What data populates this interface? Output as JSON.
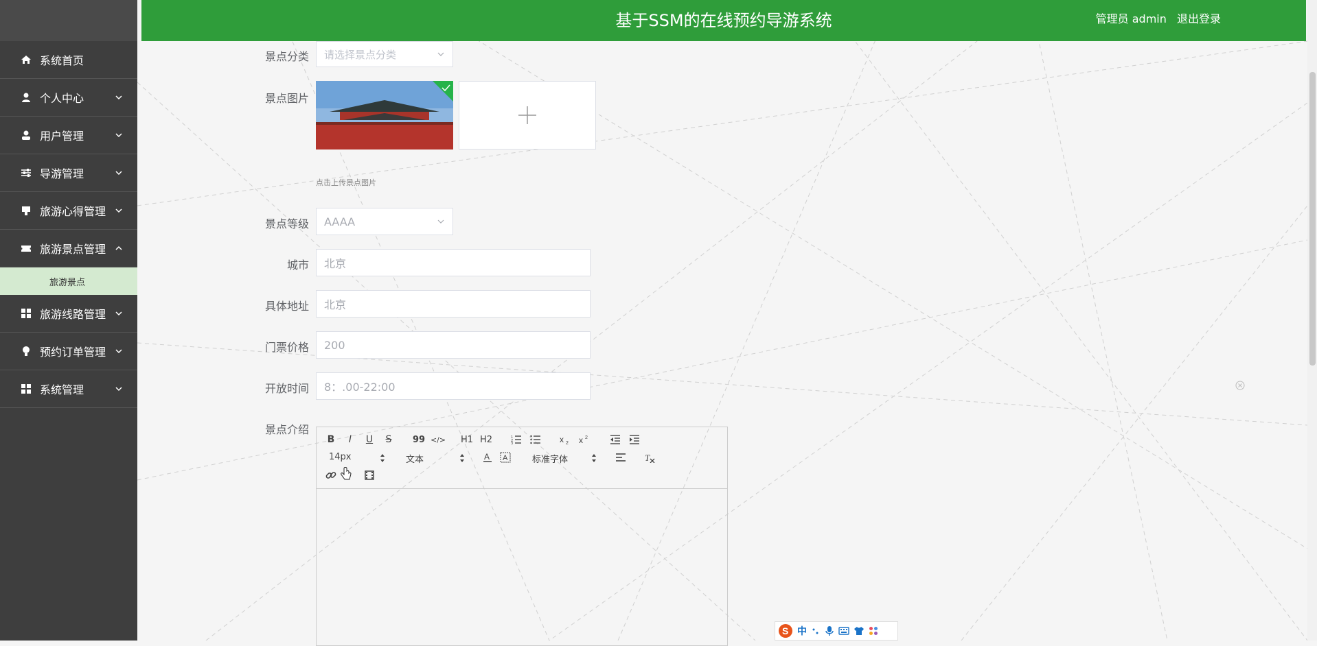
{
  "header": {
    "title": "基于SSM的在线预约导游系统",
    "user_label": "管理员 admin",
    "logout_label": "退出登录",
    "bg_color": "#2f9d3a"
  },
  "sidebar": {
    "items": [
      {
        "label": "系统首页",
        "icon": "home-icon"
      },
      {
        "label": "个人中心",
        "icon": "user-icon"
      },
      {
        "label": "用户管理",
        "icon": "user-manage-icon"
      },
      {
        "label": "导游管理",
        "icon": "sliders-icon"
      },
      {
        "label": "旅游心得管理",
        "icon": "notes-icon"
      },
      {
        "label": "旅游景点管理",
        "icon": "ticket-icon"
      },
      {
        "label": "旅游线路管理",
        "icon": "grid-icon"
      },
      {
        "label": "预约订单管理",
        "icon": "bulb-icon"
      },
      {
        "label": "系统管理",
        "icon": "grid-icon"
      }
    ],
    "submenu": {
      "label": "旅游景点"
    }
  },
  "form": {
    "category": {
      "label": "景点分类",
      "placeholder": "请选择景点分类"
    },
    "image": {
      "label": "景点图片",
      "hint": "点击上传景点图片"
    },
    "level": {
      "label": "景点等级",
      "value": "AAAA"
    },
    "city": {
      "label": "城市",
      "value": "北京"
    },
    "address": {
      "label": "具体地址",
      "value": "北京"
    },
    "price": {
      "label": "门票价格",
      "value": "200"
    },
    "open_time": {
      "label": "开放时间",
      "value": "8：.00-22:00"
    },
    "intro": {
      "label": "景点介绍"
    }
  },
  "editor": {
    "font_size": "14px",
    "text_type": "文本",
    "font_family": "标准字体",
    "h1": "H1",
    "h2": "H2",
    "bold": "B",
    "italic": "I",
    "underline": "U",
    "strike": "S",
    "quote": "99",
    "code": "</>"
  },
  "ime": {
    "label": "中"
  }
}
